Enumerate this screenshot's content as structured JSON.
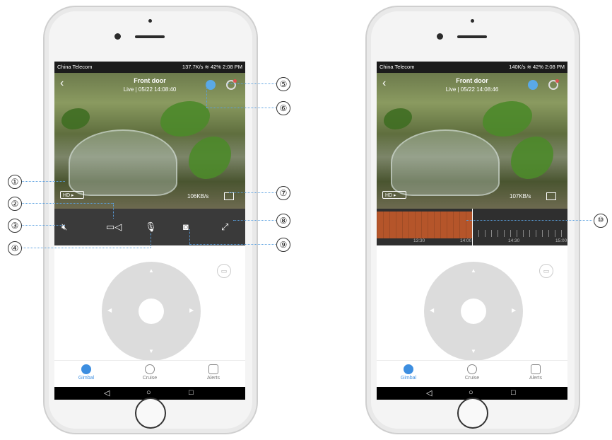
{
  "screen1": {
    "status": {
      "carrier": "China Telecom",
      "right": "137.7K/s ≋ 42% 2:08 PM"
    },
    "video": {
      "title": "Front door",
      "subtitle": "Live | 05/22 14:08:40",
      "quality": "HD ▸",
      "speed": "106KB/s"
    },
    "controls": [
      "mute-icon",
      "record-icon",
      "mic-icon",
      "snapshot-icon",
      "expand-icon"
    ]
  },
  "screen2": {
    "status": {
      "carrier": "China Telecom",
      "right": "140K/s ≋ 42% 2:08 PM"
    },
    "video": {
      "title": "Front door",
      "subtitle": "Live | 05/22 14:08:46",
      "quality": "HD ▸",
      "speed": "107KB/s"
    },
    "timeline": {
      "labels": [
        "13:30",
        "14:00",
        "14:30",
        "15:00"
      ]
    }
  },
  "tabs": [
    {
      "label": "Gimbal",
      "active": true
    },
    {
      "label": "Cruise",
      "active": false
    },
    {
      "label": "Alerts",
      "active": false
    }
  ],
  "nav": {
    "back": "◁",
    "home": "○",
    "recent": "□"
  },
  "callouts": [
    "①",
    "②",
    "③",
    "④",
    "⑤",
    "⑥",
    "⑦",
    "⑧",
    "⑨",
    "⑩"
  ],
  "colors": {
    "accent": "#3d8ee0",
    "recording": "#b5552a",
    "callout_line": "#5aa0e0"
  }
}
